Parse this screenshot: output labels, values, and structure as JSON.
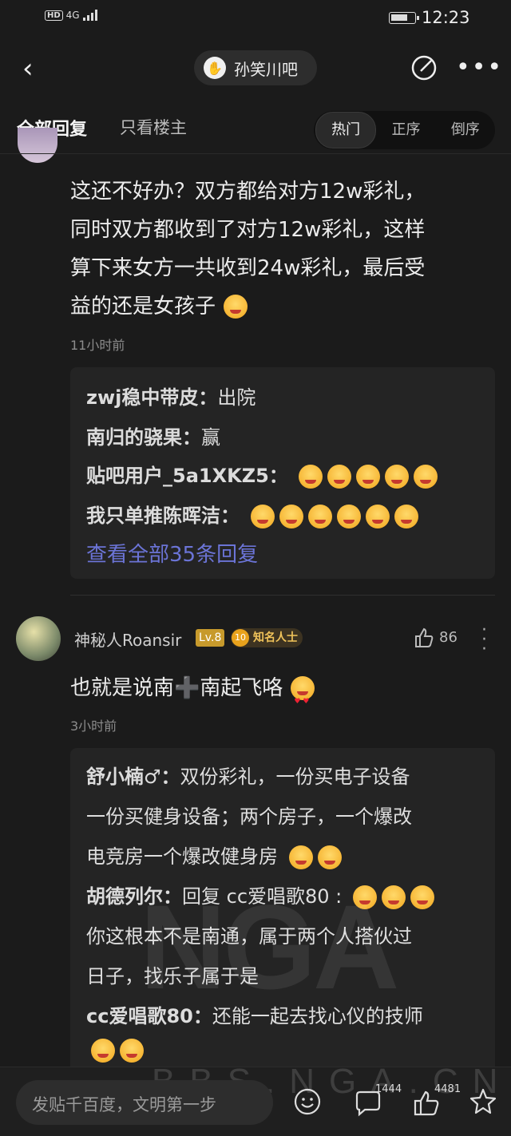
{
  "status_bar": {
    "network": "4G",
    "hd": "HD",
    "time": "12:23",
    "battery_level": 0.75
  },
  "nav": {
    "forum_name": "孙笑川吧"
  },
  "tabs": {
    "all": "全部回复",
    "op_only": "只看楼主",
    "sort": [
      "热门",
      "正序",
      "倒序"
    ],
    "sort_active": "热门"
  },
  "post1": {
    "lines": [
      "这还不好办？双方都给对方12w彩礼，",
      "同时双方都收到了对方12w彩礼，这样",
      "算下来女方一共收到24w彩礼，最后受",
      "益的还是女孩子"
    ],
    "time": "11小时前",
    "replies": [
      {
        "name": "zwj稳中带皮：",
        "text": "出院"
      },
      {
        "name": "南归的骁果：",
        "text": "赢"
      },
      {
        "name": "贴吧用户_5a1XKZ5：",
        "text": ""
      },
      {
        "name": "我只单推陈晖洁：",
        "text": ""
      }
    ],
    "view_all": "查看全部35条回复"
  },
  "post2": {
    "user": "神秘人Roansir",
    "level": "Lv.8",
    "medal_num": "10",
    "medal": "知名人士",
    "likes": "86",
    "text": "也就是说南➕南起飞咯",
    "time": "3小时前",
    "replies": [
      {
        "name": "舒小楠♂：",
        "text": "双份彩礼，一份买电子设备"
      },
      {
        "cont": "一份买健身设备；两个房子，一个爆改"
      },
      {
        "cont": "电竞房一个爆改健身房"
      },
      {
        "name": "胡德列尔：",
        "text": "回复 cc爱唱歌80 :"
      },
      {
        "cont": "你这根本不是南通，属于两个人搭伙过"
      },
      {
        "cont": "日子，找乐子属于是"
      },
      {
        "name": "cc爱唱歌80：",
        "text": "还能一起去找心仪的技师"
      }
    ]
  },
  "watermark": {
    "logo": "NGA",
    "site": "BBS.NGA.CN"
  },
  "bottom": {
    "placeholder": "发贴千百度，文明第一步",
    "comments": "1444",
    "likes": "4481"
  }
}
